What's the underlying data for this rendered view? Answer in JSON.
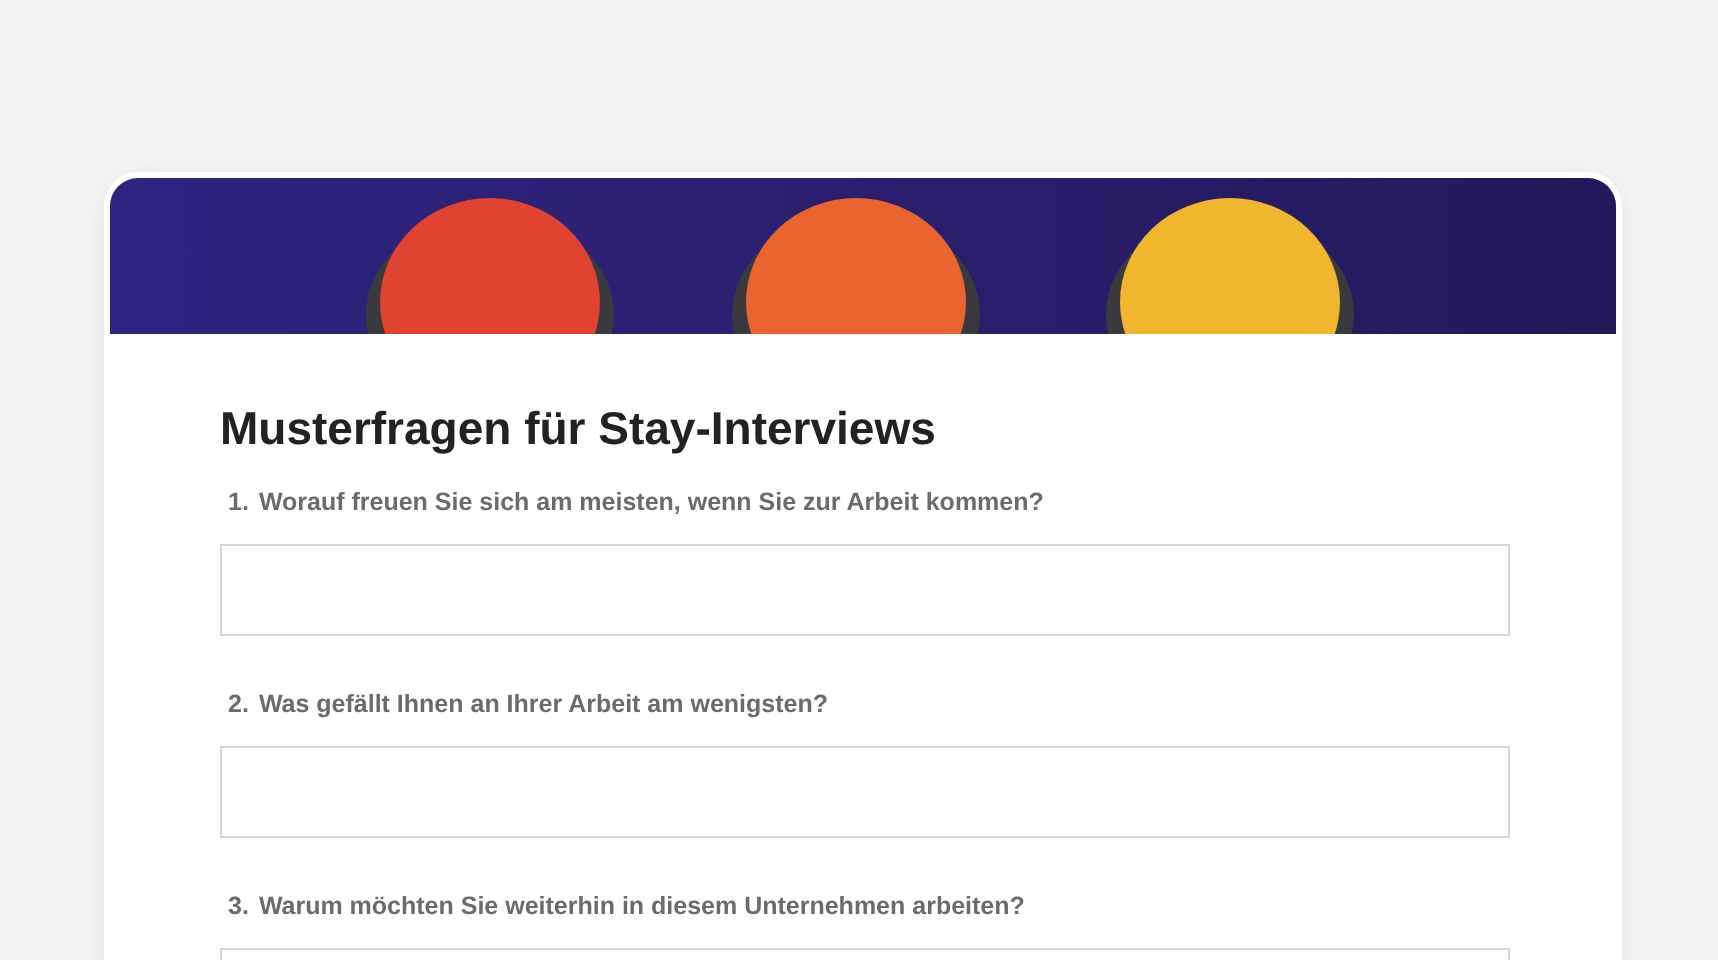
{
  "form": {
    "title": "Musterfragen für Stay-Interviews",
    "questions": [
      {
        "number": "1.",
        "label": "Worauf freuen Sie sich am meisten, wenn Sie zur Arbeit kommen?"
      },
      {
        "number": "2.",
        "label": "Was gefällt Ihnen an Ihrer Arbeit am wenigsten?"
      },
      {
        "number": "3.",
        "label": "Warum möchten Sie weiterhin in diesem Unternehmen arbeiten?"
      }
    ]
  }
}
